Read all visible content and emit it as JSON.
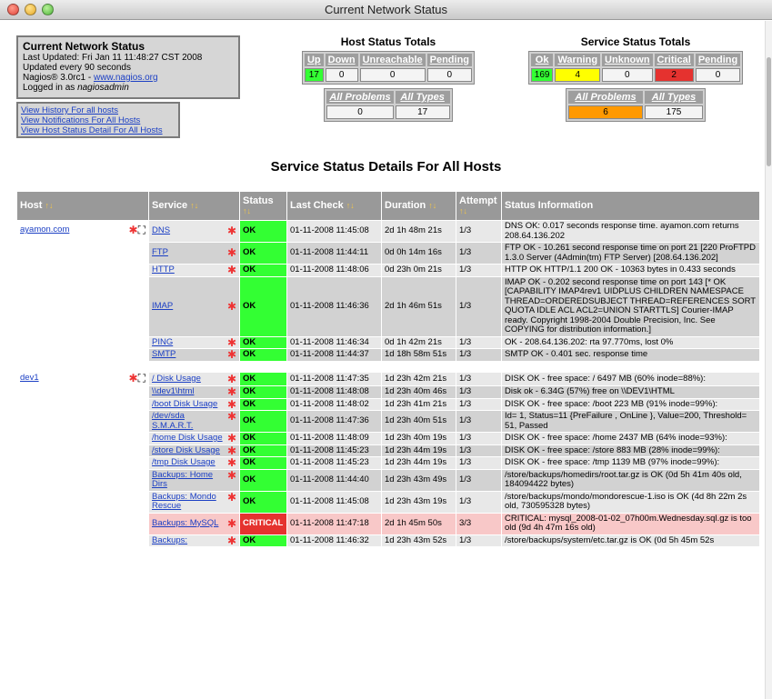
{
  "window": {
    "title": "Current Network Status"
  },
  "info": {
    "heading": "Current Network Status",
    "last_updated": "Last Updated: Fri Jan 11 11:48:27 CST 2008",
    "refresh": "Updated every 90 seconds",
    "version_prefix": "Nagios® 3.0rc1 - ",
    "version_link": "www.nagios.org",
    "logged_in_prefix": "Logged in as ",
    "logged_in_user": "nagiosadmin"
  },
  "links": [
    "View History For all hosts",
    "View Notifications For All Hosts",
    "View Host Status Detail For All Hosts"
  ],
  "host_totals": {
    "title": "Host Status Totals",
    "headers": [
      "Up",
      "Down",
      "Unreachable",
      "Pending"
    ],
    "values": [
      "17",
      "0",
      "0",
      "0"
    ],
    "all_headers": [
      "All Problems",
      "All Types"
    ],
    "all_values": [
      "0",
      "17"
    ]
  },
  "service_totals": {
    "title": "Service Status Totals",
    "headers": [
      "Ok",
      "Warning",
      "Unknown",
      "Critical",
      "Pending"
    ],
    "values": [
      "169",
      "4",
      "0",
      "2",
      "0"
    ],
    "all_headers": [
      "All Problems",
      "All Types"
    ],
    "all_values": [
      "6",
      "175"
    ]
  },
  "main_title": "Service Status Details For All Hosts",
  "table": {
    "headers": [
      "Host",
      "Service",
      "Status",
      "Last Check",
      "Duration",
      "Attempt",
      "Status Information"
    ],
    "groups": [
      {
        "host": "ayamon.com",
        "rows": [
          {
            "service": "DNS",
            "status": "OK",
            "last_check": "01-11-2008 11:45:08",
            "duration": "2d 1h 48m 21s",
            "attempt": "1/3",
            "info": "DNS OK: 0.017 seconds response time. ayamon.com returns 208.64.136.202"
          },
          {
            "service": "FTP",
            "status": "OK",
            "last_check": "01-11-2008 11:44:11",
            "duration": "0d 0h 14m 16s",
            "attempt": "1/3",
            "info": "FTP OK - 10.261 second response time on port 21 [220 ProFTPD 1.3.0 Server (4Admin(tm) FTP Server) [208.64.136.202]"
          },
          {
            "service": "HTTP",
            "status": "OK",
            "last_check": "01-11-2008 11:48:06",
            "duration": "0d 23h 0m 21s",
            "attempt": "1/3",
            "info": "HTTP OK HTTP/1.1 200 OK - 10363 bytes in 0.433 seconds"
          },
          {
            "service": "IMAP",
            "status": "OK",
            "last_check": "01-11-2008 11:46:36",
            "duration": "2d 1h 46m 51s",
            "attempt": "1/3",
            "info": "IMAP OK - 0.202 second response time on port 143 [* OK [CAPABILITY IMAP4rev1 UIDPLUS CHILDREN NAMESPACE THREAD=ORDEREDSUBJECT THREAD=REFERENCES SORT QUOTA IDLE ACL ACL2=UNION STARTTLS] Courier-IMAP ready. Copyright 1998-2004 Double Precision, Inc. See COPYING for distribution information.]"
          },
          {
            "service": "PING",
            "status": "OK",
            "last_check": "01-11-2008 11:46:34",
            "duration": "0d 1h 42m 21s",
            "attempt": "1/3",
            "info": "OK - 208.64.136.202: rta 97.770ms, lost 0%"
          },
          {
            "service": "SMTP",
            "status": "OK",
            "last_check": "01-11-2008 11:44:37",
            "duration": "1d 18h 58m 51s",
            "attempt": "1/3",
            "info": "SMTP OK - 0.401 sec. response time"
          }
        ]
      },
      {
        "host": "dev1",
        "rows": [
          {
            "service": "/ Disk Usage",
            "status": "OK",
            "last_check": "01-11-2008 11:47:35",
            "duration": "1d 23h 42m 21s",
            "attempt": "1/3",
            "info": "DISK OK - free space: / 6497 MB (60% inode=88%):"
          },
          {
            "service": "\\\\dev1\\html",
            "status": "OK",
            "last_check": "01-11-2008 11:48:08",
            "duration": "1d 23h 40m 46s",
            "attempt": "1/3",
            "info": "Disk ok - 6.34G (57%) free on \\\\DEV1\\HTML"
          },
          {
            "service": "/boot Disk Usage",
            "status": "OK",
            "last_check": "01-11-2008 11:48:02",
            "duration": "1d 23h 41m 21s",
            "attempt": "1/3",
            "info": "DISK OK - free space: /boot 223 MB (91% inode=99%):"
          },
          {
            "service": "/dev/sda S.M.A.R.T.",
            "status": "OK",
            "last_check": "01-11-2008 11:47:36",
            "duration": "1d 23h 40m 51s",
            "attempt": "1/3",
            "info": "Id= 1, Status=11 {PreFailure , OnLine }, Value=200, Threshold= 51, Passed"
          },
          {
            "service": "/home Disk Usage",
            "status": "OK",
            "last_check": "01-11-2008 11:48:09",
            "duration": "1d 23h 40m 19s",
            "attempt": "1/3",
            "info": "DISK OK - free space: /home 2437 MB (64% inode=93%):"
          },
          {
            "service": "/store Disk Usage",
            "status": "OK",
            "last_check": "01-11-2008 11:45:23",
            "duration": "1d 23h 44m 19s",
            "attempt": "1/3",
            "info": "DISK OK - free space: /store 883 MB (28% inode=99%):"
          },
          {
            "service": "/tmp Disk Usage",
            "status": "OK",
            "last_check": "01-11-2008 11:45:23",
            "duration": "1d 23h 44m 19s",
            "attempt": "1/3",
            "info": "DISK OK - free space: /tmp 1139 MB (97% inode=99%):"
          },
          {
            "service": "Backups: Home Dirs",
            "status": "OK",
            "last_check": "01-11-2008 11:44:40",
            "duration": "1d 23h 43m 49s",
            "attempt": "1/3",
            "info": "/store/backups/homedirs/root.tar.gz is OK (0d 5h 41m 40s old, 184094422 bytes)"
          },
          {
            "service": "Backups: Mondo Rescue",
            "status": "OK",
            "last_check": "01-11-2008 11:45:08",
            "duration": "1d 23h 43m 19s",
            "attempt": "1/3",
            "info": "/store/backups/mondo/mondorescue-1.iso is OK (4d 8h 22m 2s old, 730595328 bytes)"
          },
          {
            "service": "Backups: MySQL",
            "status": "CRITICAL",
            "last_check": "01-11-2008 11:47:18",
            "duration": "2d 1h 45m 50s",
            "attempt": "3/3",
            "info": "CRITICAL: mysql_2008-01-02_07h00m.Wednesday.sql.gz is too old (9d 4h 47m 16s old)"
          },
          {
            "service": "Backups:",
            "status": "OK",
            "last_check": "01-11-2008 11:46:32",
            "duration": "1d 23h 43m 52s",
            "attempt": "1/3",
            "info": "/store/backups/system/etc.tar.gz is OK (0d 5h 45m 52s"
          }
        ]
      }
    ]
  },
  "colors": {
    "ok": "#33ff33",
    "critical": "#e5322f",
    "warning": "#ffff00",
    "pending": "#ff9900"
  }
}
